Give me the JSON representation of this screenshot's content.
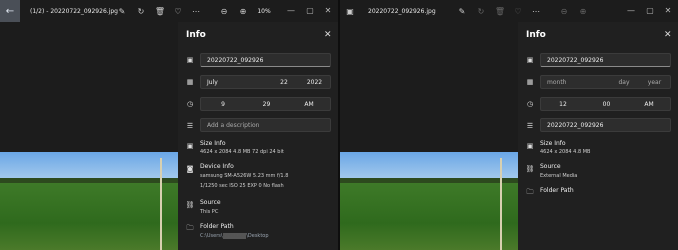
{
  "left": {
    "title": "(1/2) - 20220722_092926.jpg",
    "zoom": "10%",
    "panel": {
      "title": "Info",
      "name_value": "20220722_092926",
      "date": {
        "month": "July",
        "day": "22",
        "year": "2022"
      },
      "time": {
        "hour": "9",
        "minute": "29",
        "ampm": "AM"
      },
      "description_placeholder": "Add a description",
      "size_label": "Size Info",
      "size_detail": "4624 x 2084    4.8 MB    72 dpi    24 bit",
      "device_label": "Device Info",
      "device_line1": "samsung    SM-A526W    5.23 mm    f/1.8",
      "device_line2": "1/1250 sec    ISO 25    EXP 0    No flash",
      "source_label": "Source",
      "source_value": "This PC",
      "folder_label": "Folder Path",
      "folder_prefix": "C:\\Users\\",
      "folder_suffix": "\\Desktop"
    }
  },
  "right": {
    "title": "20220722_092926.jpg",
    "panel": {
      "title": "Info",
      "name_value": "20220722_092926",
      "date": {
        "month": "month",
        "day": "day",
        "year": "year"
      },
      "time": {
        "hour": "12",
        "minute": "00",
        "ampm": "AM"
      },
      "name2_value": "20220722_092926",
      "size_label": "Size Info",
      "size_detail": "4624 x 2084    4.8 MB",
      "source_label": "Source",
      "source_value": "External Media",
      "folder_label": "Folder Path"
    }
  },
  "colors": {
    "panel": "#202020",
    "accent_back": "#4a4f57"
  }
}
